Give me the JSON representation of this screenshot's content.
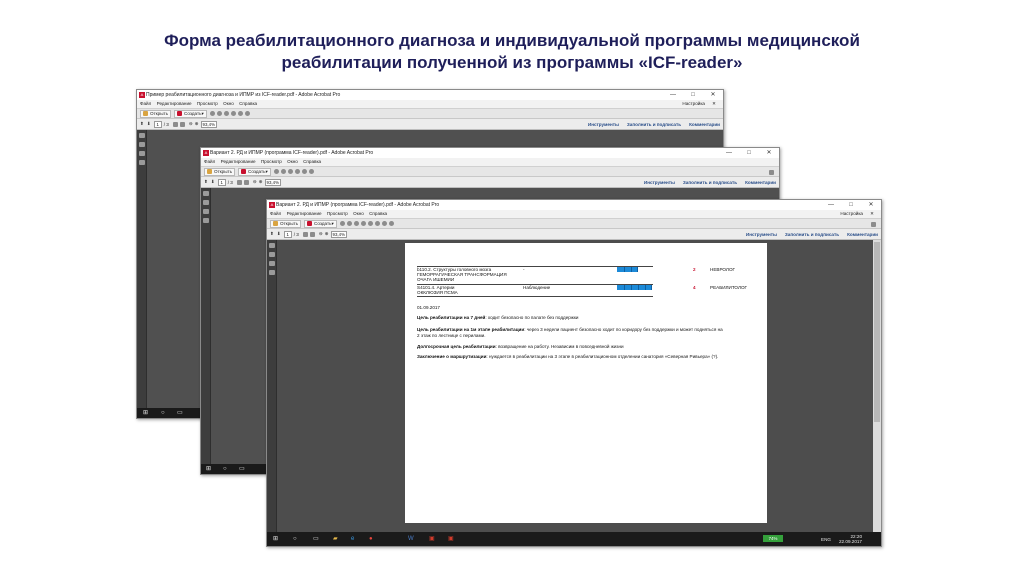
{
  "slide": {
    "title_line1": "Форма реабилитационного диагноза и индивидуальной программы медицинской",
    "title_line2": "реабилитации полученной из программы «ICF-reader»"
  },
  "app": {
    "menu": [
      "Файл",
      "Редактирование",
      "Просмотр",
      "Окно",
      "Справка"
    ],
    "settings_label": "Настройка",
    "open_label": "Открыть",
    "create_label": "Создать",
    "page_total_back": "/ 3",
    "page_total": "/ 3",
    "page_current": "1",
    "zoom": "93,4%",
    "tools_label": "Инструменты",
    "fill_sign_label": "Заполнить и подписать",
    "comments_label": "Комментарии"
  },
  "windows": [
    {
      "title": "Пример реабилитационного диагноза и ИПМР из ICF-reader.pdf - Adobe Acrobat Pro"
    },
    {
      "title": "Вариант 2. РД и ИПМР (программа ICF-reader).pdf - Adobe Acrobat Pro"
    },
    {
      "title": "Вариант 2. РД и ИПМР (программа ICF-reader).pdf - Adobe Acrobat Pro"
    }
  ],
  "document": {
    "row1": {
      "code_name": "b110.2. Структуры головного мозга",
      "desc1": "ГЕМОРРАГИЧЕСКАЯ ТРАНСФОРМАЦИЯ",
      "desc2": "ОЧАГА ИШЕМИИ",
      "value": "-",
      "level_filled": 3,
      "number": "2",
      "specialist": "НЕВРОЛОГ"
    },
    "row2": {
      "code_name": "S4101.4. Артерии",
      "desc1": "ОККЛЮЗИЯ ПСМА",
      "value": "Наблюдение",
      "level_filled": 5,
      "number": "4",
      "specialist": "РЕАБИЛИТОЛОГ"
    },
    "date": "01.09.2017",
    "goal7_label": "Цель реабилитации на 7 дней",
    "goal7_text": ": ходит безопасно по палате без поддержки",
    "goal1_label": "Цель реабилитации на 1м этапе реабилитации",
    "goal1_text": ": через 3 недели пациент безопасно ходит по коридору без поддержки и может подняться на",
    "goal1_text2": "2 этаж по лестнице с перилами.",
    "longterm_label": "Долгосрочная цель реабилитации",
    "longterm_text": ": возвращение на работу. Независим в повседневной жизни",
    "routing_label": "Заключение о маршрутизации",
    "routing_text": ": нуждается в реабилитации на 3 этапе в реабилитационном отделении санатория «Северная Ривьера» (?)."
  },
  "taskbar": {
    "lang": "ENG",
    "time": "22:20",
    "date": "22.09.2017",
    "battery": "74%"
  },
  "icons": [
    "windows-start-icon",
    "search-icon",
    "task-view-icon",
    "folder-icon",
    "edge-icon",
    "chrome-icon",
    "word-icon",
    "pdf-icon"
  ],
  "colors": {
    "title": "#1f1f5a",
    "level_fill": "#1c8ad8",
    "links": "#2b4f8a"
  }
}
